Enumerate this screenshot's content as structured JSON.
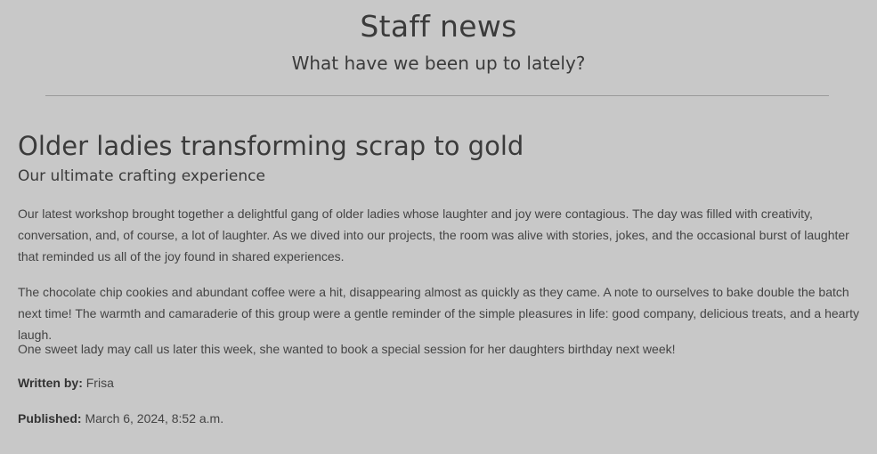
{
  "header": {
    "title": "Staff news",
    "subtitle": "What have we been up to lately?"
  },
  "article": {
    "title": "Older ladies transforming scrap to gold",
    "subtitle": "Our ultimate crafting experience",
    "paragraphs": [
      "Our latest workshop brought together a delightful gang of older ladies whose laughter and joy were contagious. The day was filled with creativity, conversation, and, of course, a lot of laughter. As we dived into our projects, the room was alive with stories, jokes, and the occasional burst of laughter that reminded us all of the joy found in shared experiences.",
      "The chocolate chip cookies and abundant coffee were a hit, disappearing almost as quickly as they came. A note to ourselves to bake double the batch next time! The warmth and camaraderie of this group were a gentle reminder of the simple pleasures in life: good company, delicious treats, and a hearty laugh.",
      "One sweet lady may call us later this week, she wanted to book a special session for her daughters birthday next week!"
    ],
    "author_label": "Written by:",
    "author": "Frisa",
    "published_label": "Published:",
    "published": "March 6, 2024, 8:52 a.m."
  },
  "colors": {
    "background": "#c8c8c8",
    "text": "#3a3a3a",
    "divider": "#9a9a9a"
  }
}
